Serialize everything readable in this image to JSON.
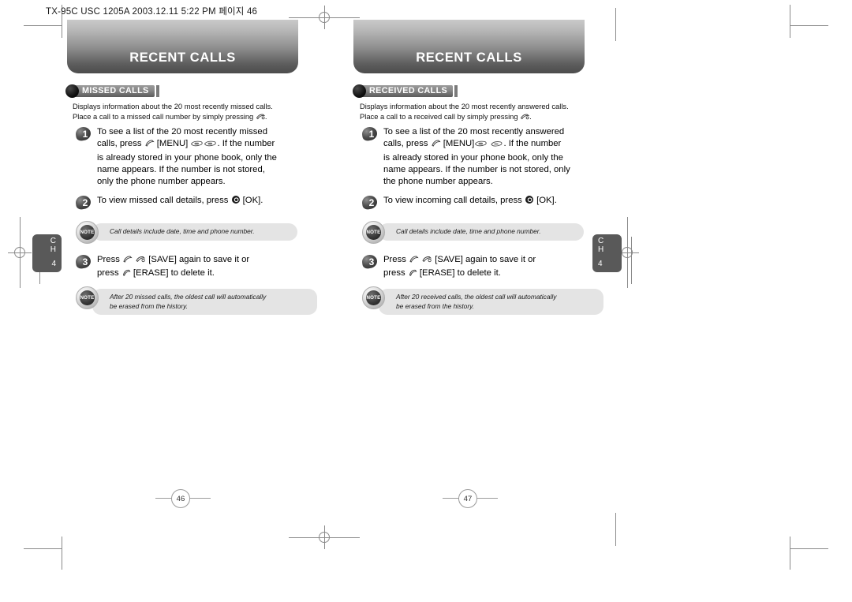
{
  "document": {
    "header_line": "TX-95C USC 1205A  2003.12.11 5:22 PM  페이지 46"
  },
  "left_page": {
    "banner_title": "RECENT CALLS",
    "section_badge": "MISSED CALLS",
    "intro_lines": [
      "Displays information about the 20 most recently missed calls.",
      "Place a call to a missed call number by simply pressing"
    ],
    "steps": [
      {
        "number": "1",
        "lines": [
          "To see a list of the 20 most recently missed",
          "calls, press     [MENU]         . If the number",
          "is already stored in your phone book, only the",
          "name appears. If the number is not stored,",
          "only the phone number appears."
        ]
      },
      {
        "number": "2",
        "lines": [
          "To view missed call details, press     [OK]."
        ]
      },
      {
        "number": "3",
        "lines": [
          "Press          [SAVE] again to save it or",
          "press     [ERASE] to delete it."
        ]
      }
    ],
    "note_top": {
      "badge_label": "NOTE",
      "lines": [
        "Call details include date, time and phone number."
      ]
    },
    "note_bottom": {
      "badge_label": "NOTE",
      "lines": [
        "After 20 missed calls, the oldest call will automatically",
        "be erased from the history."
      ]
    },
    "chapter_tab": {
      "ch_top": "C",
      "ch_bottom": "H",
      "number": "4"
    },
    "page_number": "46"
  },
  "right_page": {
    "banner_title": "RECENT CALLS",
    "section_badge": "RECEIVED CALLS",
    "intro_lines": [
      "Displays information about the 20 most recently answered calls.",
      "Place a call to a received call by simply pressing"
    ],
    "steps": [
      {
        "number": "1",
        "lines": [
          "To see a list of the 20 most recently answered",
          "calls, press     [MENU]        . If  the  number",
          "is already stored in your phone book, only the",
          "name appears. If the number is not stored, only",
          "the phone number appears."
        ]
      },
      {
        "number": "2",
        "lines": [
          "To view incoming call details, press     [OK]."
        ]
      },
      {
        "number": "3",
        "lines": [
          "Press          [SAVE] again to save it or",
          "press     [ERASE] to delete it."
        ]
      }
    ],
    "note_top": {
      "badge_label": "NOTE",
      "lines": [
        "Call details include date, time and phone number."
      ]
    },
    "note_bottom": {
      "badge_label": "NOTE",
      "lines": [
        "After 20 received calls, the oldest call will automatically",
        "be erased from the history."
      ]
    },
    "chapter_tab": {
      "ch_top": "C",
      "ch_bottom": "H",
      "number": "4"
    },
    "page_number": "47"
  },
  "icons": {
    "send_key": "send-key-icon",
    "menu_key": "menu-key-icon",
    "soft_key": "soft-key-icon",
    "ok_key": "ok-key-icon",
    "registration_mark": "registration-mark-icon",
    "crop_mark": "crop-mark-icon"
  },
  "colors": {
    "banner_dark": "#4c4c4c",
    "banner_light": "#c9c9c9",
    "note_bg": "#e4e4e4",
    "tab_bg": "#595959",
    "rule": "#9b9b9b"
  }
}
